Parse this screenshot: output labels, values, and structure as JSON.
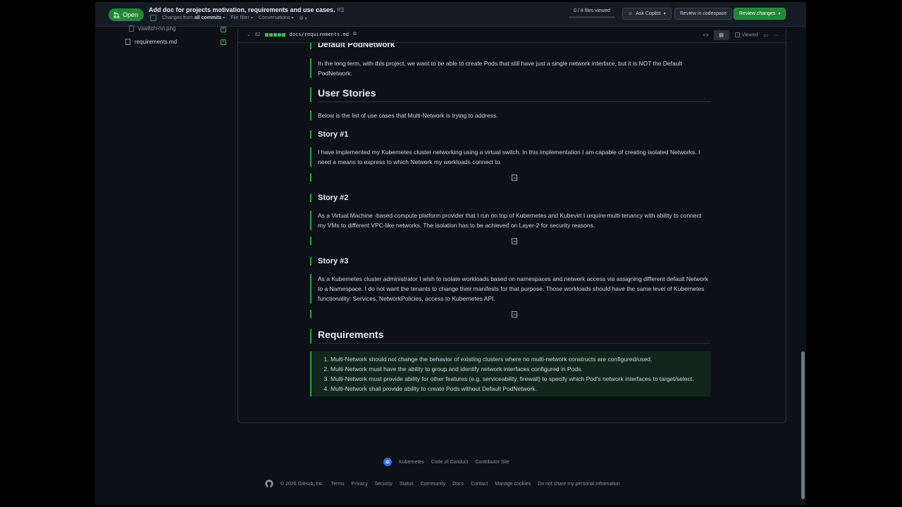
{
  "header": {
    "status": "Open",
    "title": "Add doc for projects motivation, requirements and use cases.",
    "pr_number": "#3",
    "changes_from_label": "Changes from",
    "changes_from_value": "all commits",
    "file_filter": "File filter",
    "conversations": "Conversations",
    "files_viewed": "0 / 4 files viewed",
    "files_viewed_fraction": 0,
    "ask_copilot": "Ask Copilot",
    "review_codespace": "Review in codespace",
    "review_changes": "Review changes"
  },
  "sidebar": {
    "files": [
      {
        "name": "vswitch-nn.png"
      },
      {
        "name": "requirements.md"
      }
    ]
  },
  "diff": {
    "lines_added": "82",
    "path": "docs/requirements.md",
    "viewed_label": "Viewed"
  },
  "content": {
    "default_podnetwork_heading": "Default PodNetwork",
    "default_podnetwork_text": "In the long term, with this project, we want to be able to create Pods that still have just a single network interface, but it is NOT the Default PodNetwork.",
    "user_stories_heading": "User Stories",
    "user_stories_intro": "Below is the list of use cases that Multi-Network is trying to address.",
    "stories": [
      {
        "title": "Story #1",
        "text": "I have implemented my Kubernetes cluster networking using a virtual switch. In this implementation I am capable of creating isolated Networks. I need a means to express to which Network my workloads connect to."
      },
      {
        "title": "Story #2",
        "text": "As a Virtual Machine -based compute platform provider that I run on top of Kubernetes and Kubevirt I require multi-tenancy with ability to connect my VMs to different VPC-like networks. The isolation has to be achieved on Layer-2 for security reasons."
      },
      {
        "title": "Story #3",
        "text": "As a Kubernetes cluster administrator I wish to isolate workloads based on namespaces and network access via assigning different default Network to a Namespace. I do not want the tenants to change their manifests for that purpose. Those workloads should have the same level of Kubernetes functionality: Services, NetworkPolicies, access to Kubernetes API."
      }
    ],
    "requirements_heading": "Requirements",
    "requirements": [
      "Multi-Network should not change the behavior of existing clusters where no multi-network constructs are configured/used.",
      "Multi-Network must have the ability to group and identify network interfaces configured in Pods.",
      "Multi-Network must provide ability for other features (e.g. serviceability, firewall) to specify which Pod's network interfaces to target/select.",
      "Multi-Network shall provide ability to create Pods without Default PodNetwork."
    ]
  },
  "footer": {
    "org_links": [
      "Kubernetes",
      "Code of Conduct",
      "Contributor Site"
    ],
    "copyright": "© 2026 GitHub, Inc.",
    "links": [
      "Terms",
      "Privacy",
      "Security",
      "Status",
      "Community",
      "Docs",
      "Contact",
      "Manage cookies",
      "Do not share my personal information"
    ]
  },
  "colors": {
    "accent_green": "#238636",
    "added_border": "#2ea043",
    "background": "#0d1117"
  }
}
